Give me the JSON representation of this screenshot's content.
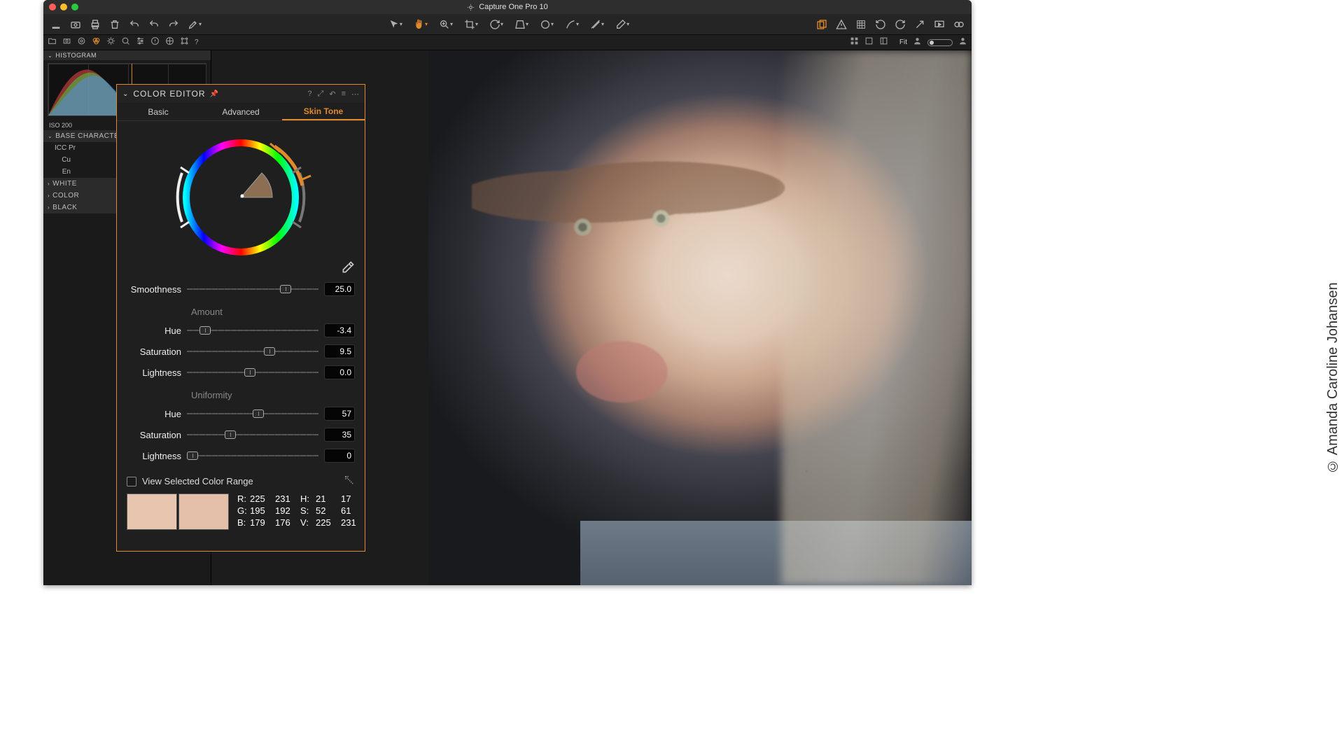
{
  "app": {
    "title": "Capture One Pro 10"
  },
  "tabstrip": {
    "fit": "Fit"
  },
  "sidebar": {
    "histogram_label": "HISTOGRAM",
    "iso": "ISO 200",
    "sections": [
      {
        "label": "BASE CHARACTERISTICS",
        "expanded": true
      },
      {
        "label": "WHITE BALANCE",
        "expanded": false
      },
      {
        "label": "COLOR EDITOR",
        "expanded": false
      },
      {
        "label": "BLACK & WHITE",
        "expanded": false
      }
    ],
    "base_rows": [
      "ICC Profile",
      "Curve",
      "Engine"
    ],
    "base_rows_display": [
      "ICC Pr",
      "Cu",
      "En"
    ]
  },
  "color_editor": {
    "title": "COLOR EDITOR",
    "tabs": [
      "Basic",
      "Advanced",
      "Skin Tone"
    ],
    "active_tab": 2,
    "smoothness": {
      "label": "Smoothness",
      "value": "25.0",
      "pos": 75
    },
    "amount_label": "Amount",
    "amount": {
      "hue": {
        "label": "Hue",
        "value": "-3.4",
        "pos": 14
      },
      "saturation": {
        "label": "Saturation",
        "value": "9.5",
        "pos": 63
      },
      "lightness": {
        "label": "Lightness",
        "value": "0.0",
        "pos": 48
      }
    },
    "uniformity_label": "Uniformity",
    "uniformity": {
      "hue": {
        "label": "Hue",
        "value": "57",
        "pos": 54
      },
      "saturation": {
        "label": "Saturation",
        "value": "35",
        "pos": 33
      },
      "lightness": {
        "label": "Lightness",
        "value": "0",
        "pos": 4
      }
    },
    "view_checkbox": "View Selected Color Range",
    "swatches": [
      "#e7c5af",
      "#e4c0aa"
    ],
    "readout": {
      "R": [
        "225",
        "231"
      ],
      "G": [
        "195",
        "192"
      ],
      "B": [
        "179",
        "176"
      ],
      "H": [
        "21",
        "17"
      ],
      "S": [
        "52",
        "61"
      ],
      "V": [
        "225",
        "231"
      ]
    }
  },
  "credit": "© Amanda Caroline Johansen"
}
